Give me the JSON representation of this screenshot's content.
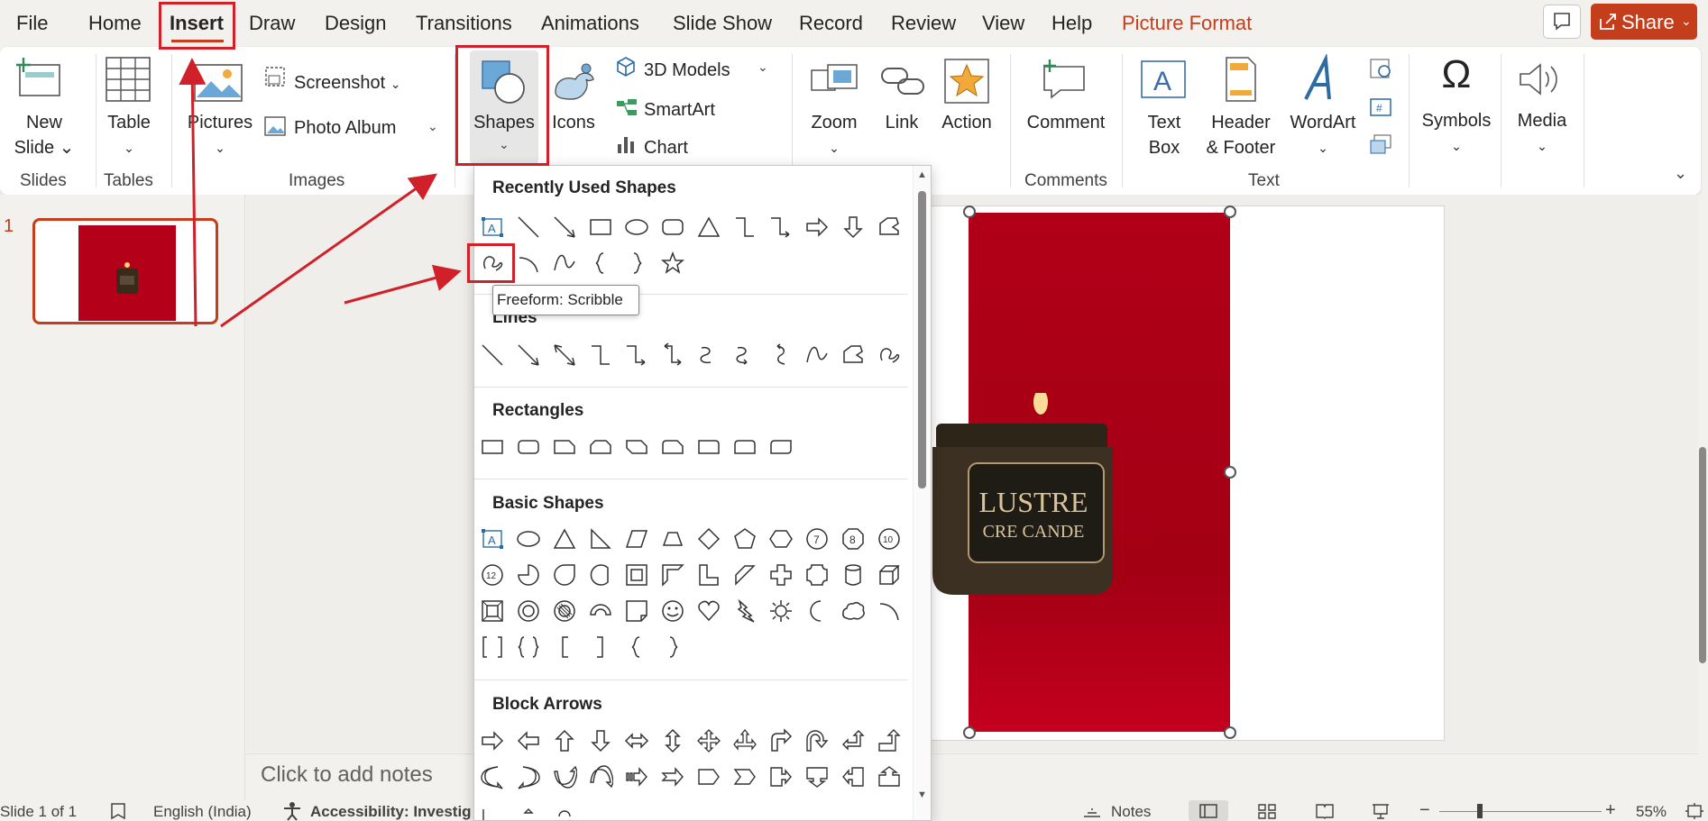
{
  "menu": {
    "tabs": [
      "File",
      "Home",
      "Insert",
      "Draw",
      "Design",
      "Transitions",
      "Animations",
      "Slide Show",
      "Record",
      "Review",
      "View",
      "Help",
      "Picture Format"
    ],
    "active": "Insert",
    "share_label": "Share"
  },
  "ribbon": {
    "new_slide": [
      "New",
      "Slide"
    ],
    "table": "Table",
    "pictures": "Pictures",
    "screenshot": "Screenshot",
    "photo_album": "Photo Album",
    "shapes": "Shapes",
    "icons": "Icons",
    "models_3d": "3D Models",
    "smartart": "SmartArt",
    "chart": "Chart",
    "zoom": "Zoom",
    "link": "Link",
    "action": "Action",
    "comment": "Comment",
    "text_box": [
      "Text",
      "Box"
    ],
    "header_footer": [
      "Header",
      "& Footer"
    ],
    "wordart": "WordArt",
    "symbols": "Symbols",
    "media": "Media",
    "groups": {
      "slides": "Slides",
      "tables": "Tables",
      "images": "Images",
      "comments": "Comments",
      "text": "Text"
    }
  },
  "slides": {
    "number": "1"
  },
  "photo_text": {
    "brand": "LUSTRE",
    "sub": "CRE CANDE"
  },
  "notes_placeholder": "Click to add notes",
  "gallery": {
    "sections": [
      "Recently Used Shapes",
      "Lines",
      "Rectangles",
      "Basic Shapes",
      "Block Arrows"
    ],
    "tooltip": "Freeform: Scribble"
  },
  "status": {
    "slide": "Slide 1 of 1",
    "language": "English (India)",
    "accessibility": "Accessibility: Investig",
    "notes": "Notes",
    "zoom": "55%"
  },
  "colors": {
    "accent": "#c43e1c",
    "annotation": "#d0202a",
    "photo": "#b10018"
  }
}
